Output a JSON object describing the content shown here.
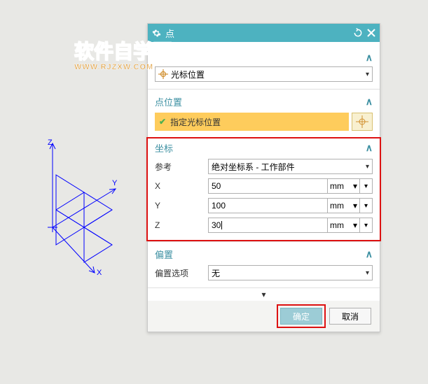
{
  "watermark": {
    "main": "软件自学网",
    "sub": "WWW.RJZXW.COM"
  },
  "titlebar": {
    "title": "点"
  },
  "section1": {
    "dropdown_value": "光标位置"
  },
  "point_location": {
    "heading": "点位置",
    "action_label": "指定光标位置"
  },
  "coordinates": {
    "heading": "坐标",
    "reference_label": "参考",
    "reference_value": "绝对坐标系 - 工作部件",
    "x_label": "X",
    "x_value": "50",
    "y_label": "Y",
    "y_value": "100",
    "z_label": "Z",
    "z_value": "30",
    "unit": "mm"
  },
  "offset": {
    "heading": "偏置",
    "option_label": "偏置选项",
    "option_value": "无"
  },
  "buttons": {
    "ok": "确定",
    "cancel": "取消"
  }
}
